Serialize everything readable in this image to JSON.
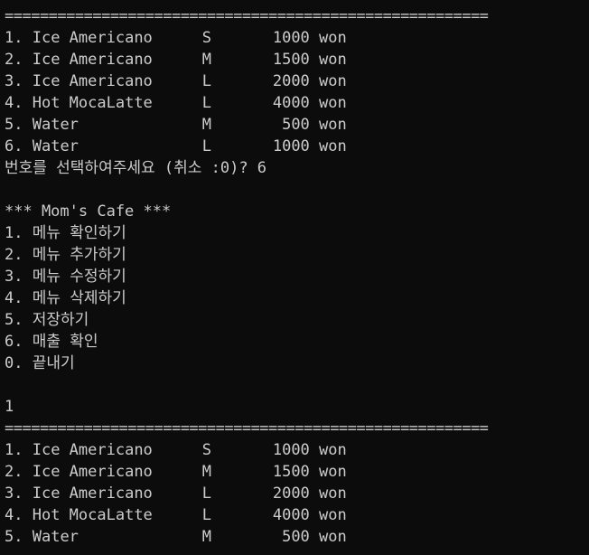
{
  "separator": "=======================================================",
  "menu_table_1": [
    {
      "num": "1.",
      "name": "Ice Americano",
      "size": "S",
      "price": "1000 won"
    },
    {
      "num": "2.",
      "name": "Ice Americano",
      "size": "M",
      "price": "1500 won"
    },
    {
      "num": "3.",
      "name": "Ice Americano",
      "size": "L",
      "price": "2000 won"
    },
    {
      "num": "4.",
      "name": "Hot MocaLatte",
      "size": "L",
      "price": "4000 won"
    },
    {
      "num": "5.",
      "name": "Water",
      "size": "M",
      "price": "500 won"
    },
    {
      "num": "6.",
      "name": "Water",
      "size": "L",
      "price": "1000 won"
    }
  ],
  "prompt_line": "번호를 선택하여주세요 (취소 :0)? 6",
  "cafe_title": "*** Mom's Cafe ***",
  "main_menu": [
    "1. 메뉴 확인하기",
    "2. 메뉴 추가하기",
    "3. 메뉴 수정하기",
    "4. 메뉴 삭제하기",
    "5. 저장하기",
    "6. 매출 확인",
    "0. 끝내기"
  ],
  "user_input": "1",
  "menu_table_2": [
    {
      "num": "1.",
      "name": "Ice Americano",
      "size": "S",
      "price": "1000 won"
    },
    {
      "num": "2.",
      "name": "Ice Americano",
      "size": "M",
      "price": "1500 won"
    },
    {
      "num": "3.",
      "name": "Ice Americano",
      "size": "L",
      "price": "2000 won"
    },
    {
      "num": "4.",
      "name": "Hot MocaLatte",
      "size": "L",
      "price": "4000 won"
    },
    {
      "num": "5.",
      "name": "Water",
      "size": "M",
      "price": "500 won"
    }
  ]
}
